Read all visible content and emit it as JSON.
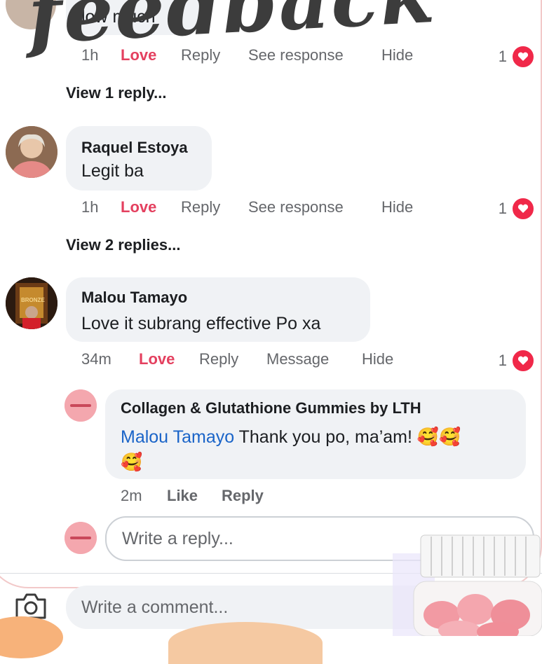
{
  "overlay_title": "feedback",
  "top_comment": {
    "text_fragment": "low much",
    "time": "1h",
    "love": "Love",
    "reply": "Reply",
    "see_response": "See response",
    "hide": "Hide",
    "reaction_count": "1",
    "view_replies": "View 1 reply..."
  },
  "comment_raquel": {
    "name": "Raquel Estoya",
    "text": "Legit ba",
    "time": "1h",
    "love": "Love",
    "reply": "Reply",
    "see_response": "See response",
    "hide": "Hide",
    "reaction_count": "1",
    "view_replies": "View 2 replies..."
  },
  "comment_malou": {
    "name": "Malou Tamayo",
    "text": "Love it subrang effective Po xa",
    "avatar_badge": "BRONZE",
    "time": "34m",
    "love": "Love",
    "reply": "Reply",
    "message": "Message",
    "hide": "Hide",
    "reaction_count": "1"
  },
  "reply_page": {
    "name": "Collagen & Glutathione Gummies by LTH",
    "mention": "Malou Tamayo",
    "text": " Thank you po, ma’am! ",
    "emoji": "🥰🥰",
    "emoji_line2": "🥰",
    "time": "2m",
    "like": "Like",
    "reply": "Reply"
  },
  "reply_input": {
    "placeholder": "Write a reply..."
  },
  "comment_input": {
    "placeholder": "Write a comment..."
  },
  "colors": {
    "love": "#e4405f",
    "bubble": "#f0f2f5",
    "mention": "#1a64c8",
    "heart": "#f02849",
    "page_avatar": "#f4a7ae"
  },
  "icons": [
    "heart-reaction-icon",
    "camera-icon"
  ]
}
